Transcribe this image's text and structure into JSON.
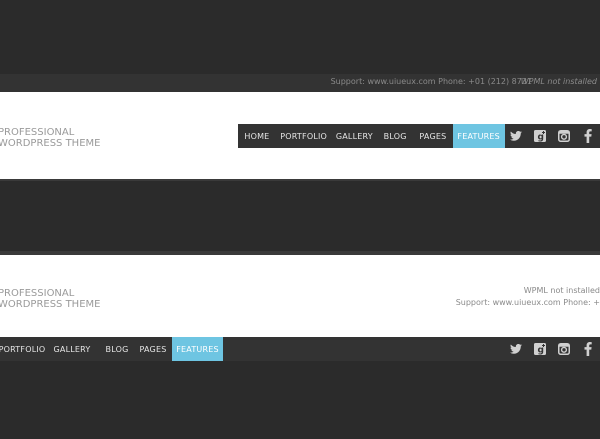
{
  "header_v1": {
    "topbar": {
      "support": "Support: www.uiueux.com Phone: +01 (212) 8731",
      "wpml": "WPML not installed"
    },
    "logo": [
      "PROFESSIONAL",
      "WORDPRESS THEME"
    ],
    "nav": [
      "HOME",
      "PORTFOLIO",
      "GALLERY",
      "BLOG",
      "PAGES",
      "FEATURES"
    ],
    "active": "FEATURES",
    "social_icons": [
      "twitter-icon",
      "google-plus-icon",
      "instagram-icon",
      "facebook-icon"
    ]
  },
  "header_v2": {
    "logo": [
      "PROFESSIONAL",
      "WORDPRESS THEME"
    ],
    "wpml": "WPML not installed",
    "support": "Support: www.uiueux.com Phone: +",
    "nav": [
      "PORTFOLIO",
      "GALLERY",
      "BLOG",
      "PAGES",
      "FEATURES"
    ],
    "active": "FEATURES",
    "social_icons": [
      "twitter-icon",
      "google-plus-icon",
      "instagram-icon",
      "facebook-icon"
    ]
  },
  "colors": {
    "background": "#2b2b2b",
    "bar": "#333333",
    "accent": "#6ec5e2",
    "header_bg": "#ffffff",
    "muted_text": "#9a9a9a"
  }
}
